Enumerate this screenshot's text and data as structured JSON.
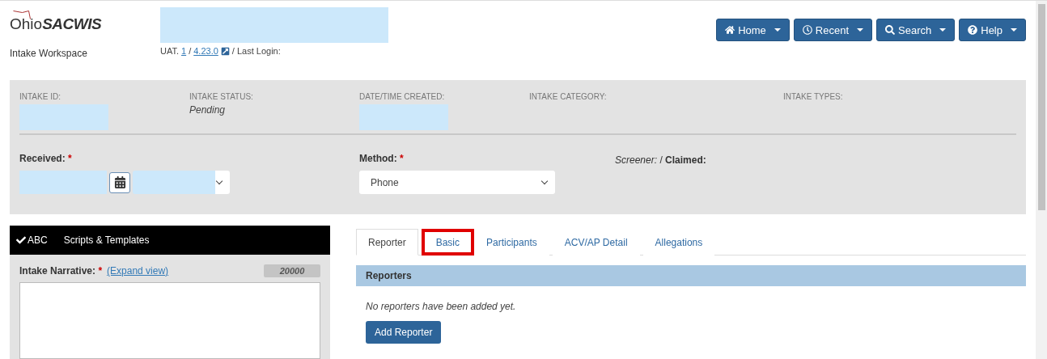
{
  "header": {
    "logo": {
      "word": "Ohio",
      "brand": "SACWIS"
    },
    "workspace": "Intake Workspace",
    "env": "UAT.",
    "env_link": "1",
    "separator": "/",
    "version": "4.23.0",
    "last_login": "/ Last Login:",
    "nav": [
      {
        "label": "Home"
      },
      {
        "label": "Recent"
      },
      {
        "label": "Search"
      },
      {
        "label": "Help"
      }
    ]
  },
  "summary": [
    {
      "label": "INTAKE ID:",
      "redacted": true
    },
    {
      "label": "INTAKE STATUS:",
      "value": "Pending",
      "redacted": false
    },
    {
      "label": "DATE/TIME CREATED:",
      "redacted": true
    },
    {
      "label": "INTAKE CATEGORY:",
      "redacted": false
    },
    {
      "label": "INTAKE TYPES:",
      "redacted": false
    }
  ],
  "form": {
    "received": {
      "label": "Received:",
      "required": "*"
    },
    "method": {
      "label": "Method:",
      "required": "*",
      "value": "Phone"
    },
    "screener": "Screener:",
    "separator": "/",
    "claimed": "Claimed:"
  },
  "scripts_bar": {
    "check": "ABC",
    "title": "Scripts & Templates"
  },
  "narrative": {
    "label": "Intake Narrative:",
    "required": "*",
    "expand": "(Expand view)",
    "counter": "20000"
  },
  "tabs": [
    {
      "label": "Reporter",
      "selected": true,
      "highlighted": false
    },
    {
      "label": "Basic",
      "selected": false,
      "highlighted": true
    },
    {
      "label": "Participants",
      "selected": false,
      "highlighted": false
    },
    {
      "label": "ACV/AP Detail",
      "selected": false,
      "highlighted": false
    },
    {
      "label": "Allegations",
      "selected": false,
      "highlighted": false
    }
  ],
  "reporters": {
    "title": "Reporters",
    "empty": "No reporters have been added yet.",
    "button": "Add Reporter"
  }
}
